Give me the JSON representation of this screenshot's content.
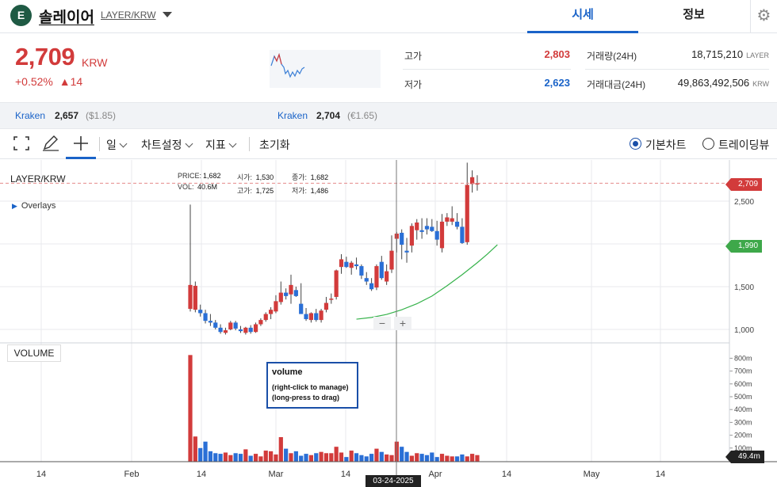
{
  "header": {
    "logo_letter": "E",
    "coin_name": "솔레이어",
    "pair": "LAYER/KRW",
    "tabs": [
      "시세",
      "정보"
    ],
    "settings_icon": "gear-icon"
  },
  "price": {
    "current": "2,709",
    "unit": "KRW",
    "change_pct": "+0.52%",
    "change_amt": "▲14"
  },
  "stats": {
    "high_label": "고가",
    "high": "2,803",
    "low_label": "저가",
    "low": "2,623",
    "volume_label": "거래량(24H)",
    "volume": "18,715,210",
    "volume_unit": "LAYER",
    "value_label": "거래대금(24H)",
    "value": "49,863,492,506",
    "value_unit": "KRW"
  },
  "exchanges": [
    {
      "name": "Kraken",
      "price": "2,657",
      "sub": "($1.85)"
    },
    {
      "name": "Kraken",
      "price": "2,704",
      "sub": "(€1.65)"
    }
  ],
  "toolbar": {
    "interval": "일",
    "settings": "차트설정",
    "indicators": "지표",
    "reset": "초기화",
    "basic_chart": "기본차트",
    "tradingview": "트레이딩뷰"
  },
  "chart": {
    "symbol": "LAYER/KRW",
    "overlays": "Overlays",
    "ohlc": {
      "price_label": "PRICE:",
      "price": "1,682",
      "open_label": "시가:",
      "open": "1,530",
      "close_label": "종가:",
      "close": "1,682",
      "vol_label": "VOL:",
      "vol": "40.6M",
      "high_label": "고가:",
      "high": "1,725",
      "low_label": "저가:",
      "low": "1,486"
    },
    "volume_label": "VOLUME",
    "tooltip_title": "volume",
    "tooltip_line1": "(right-click to manage)",
    "tooltip_line2": "(long-press to drag)",
    "current_price_tag": "2,709",
    "ma_tag": "1,990",
    "volume_tag": "49.4m",
    "crosshair_date": "03-24-2025",
    "zoom_out": "−",
    "zoom_in": "+"
  },
  "chart_data": {
    "type": "candlestick",
    "title": "LAYER/KRW",
    "price_axis_ticks": [
      "2,500",
      "2,000",
      "1,500",
      "1,000"
    ],
    "volume_axis_ticks": [
      "800m",
      "700m",
      "600m",
      "500m",
      "400m",
      "300m",
      "200m",
      "100m"
    ],
    "x_axis_ticks": [
      "14",
      "Feb",
      "14",
      "Mar",
      "14",
      "Apr",
      "14",
      "May",
      "14"
    ],
    "ylim_price": [
      900,
      2900
    ],
    "ylim_volume": [
      0,
      830
    ],
    "candles": [
      {
        "o": 1240,
        "h": 2460,
        "l": 1210,
        "c": 1520
      },
      {
        "o": 1230,
        "h": 1560,
        "l": 1200,
        "c": 1510
      },
      {
        "o": 1230,
        "h": 1290,
        "l": 1150,
        "c": 1190
      },
      {
        "o": 1190,
        "h": 1230,
        "l": 1070,
        "c": 1100
      },
      {
        "o": 1100,
        "h": 1180,
        "l": 1040,
        "c": 1080
      },
      {
        "o": 1080,
        "h": 1110,
        "l": 1000,
        "c": 1020
      },
      {
        "o": 1020,
        "h": 1060,
        "l": 950,
        "c": 970
      },
      {
        "o": 960,
        "h": 1020,
        "l": 940,
        "c": 990
      },
      {
        "o": 1000,
        "h": 1100,
        "l": 990,
        "c": 1080
      },
      {
        "o": 1080,
        "h": 1100,
        "l": 990,
        "c": 1010
      },
      {
        "o": 1000,
        "h": 1040,
        "l": 960,
        "c": 980
      },
      {
        "o": 960,
        "h": 1030,
        "l": 940,
        "c": 1020
      },
      {
        "o": 1020,
        "h": 1050,
        "l": 950,
        "c": 970
      },
      {
        "o": 970,
        "h": 1080,
        "l": 960,
        "c": 1060
      },
      {
        "o": 1060,
        "h": 1130,
        "l": 1040,
        "c": 1110
      },
      {
        "o": 1110,
        "h": 1200,
        "l": 1090,
        "c": 1180
      },
      {
        "o": 1180,
        "h": 1260,
        "l": 1120,
        "c": 1230
      },
      {
        "o": 1210,
        "h": 1400,
        "l": 1190,
        "c": 1330
      },
      {
        "o": 1320,
        "h": 1560,
        "l": 1290,
        "c": 1430
      },
      {
        "o": 1430,
        "h": 1480,
        "l": 1350,
        "c": 1390
      },
      {
        "o": 1410,
        "h": 1640,
        "l": 1300,
        "c": 1520
      },
      {
        "o": 1460,
        "h": 1500,
        "l": 1380,
        "c": 1390
      },
      {
        "o": 1300,
        "h": 1540,
        "l": 1220,
        "c": 1180
      },
      {
        "o": 1180,
        "h": 1250,
        "l": 1100,
        "c": 1120
      },
      {
        "o": 1110,
        "h": 1200,
        "l": 1080,
        "c": 1190
      },
      {
        "o": 1190,
        "h": 1240,
        "l": 1090,
        "c": 1110
      },
      {
        "o": 1110,
        "h": 1240,
        "l": 1080,
        "c": 1220
      },
      {
        "o": 1230,
        "h": 1380,
        "l": 1200,
        "c": 1310
      },
      {
        "o": 1360,
        "h": 1420,
        "l": 1300,
        "c": 1360
      },
      {
        "o": 1380,
        "h": 1700,
        "l": 1350,
        "c": 1690
      },
      {
        "o": 1730,
        "h": 1880,
        "l": 1650,
        "c": 1820
      },
      {
        "o": 1790,
        "h": 1850,
        "l": 1720,
        "c": 1730
      },
      {
        "o": 1720,
        "h": 1800,
        "l": 1640,
        "c": 1780
      },
      {
        "o": 1760,
        "h": 1840,
        "l": 1700,
        "c": 1740
      },
      {
        "o": 1740,
        "h": 1760,
        "l": 1590,
        "c": 1630
      },
      {
        "o": 1600,
        "h": 1670,
        "l": 1520,
        "c": 1560
      },
      {
        "o": 1540,
        "h": 1600,
        "l": 1450,
        "c": 1470
      },
      {
        "o": 1490,
        "h": 1760,
        "l": 1460,
        "c": 1740
      },
      {
        "o": 1790,
        "h": 1860,
        "l": 1580,
        "c": 1600
      },
      {
        "o": 1560,
        "h": 1760,
        "l": 1520,
        "c": 1680
      },
      {
        "o": 1700,
        "h": 2100,
        "l": 1660,
        "c": 1920
      },
      {
        "o": 2060,
        "h": 2140,
        "l": 1900,
        "c": 2120
      },
      {
        "o": 2130,
        "h": 2170,
        "l": 1820,
        "c": 1990
      },
      {
        "o": 1920,
        "h": 2070,
        "l": 1780,
        "c": 1900
      },
      {
        "o": 1980,
        "h": 2240,
        "l": 1900,
        "c": 2210
      },
      {
        "o": 2160,
        "h": 2290,
        "l": 2050,
        "c": 2250
      },
      {
        "o": 2160,
        "h": 2300,
        "l": 2060,
        "c": 2140
      },
      {
        "o": 2210,
        "h": 2300,
        "l": 2110,
        "c": 2170
      },
      {
        "o": 2200,
        "h": 2290,
        "l": 2140,
        "c": 2150
      },
      {
        "o": 2150,
        "h": 2270,
        "l": 1980,
        "c": 2050
      },
      {
        "o": 1950,
        "h": 2350,
        "l": 1900,
        "c": 2260
      },
      {
        "o": 2260,
        "h": 2360,
        "l": 2210,
        "c": 2310
      },
      {
        "o": 2260,
        "h": 2440,
        "l": 2220,
        "c": 2300
      },
      {
        "o": 2260,
        "h": 2360,
        "l": 2170,
        "c": 2200
      },
      {
        "o": 2200,
        "h": 2300,
        "l": 2000,
        "c": 2010
      },
      {
        "o": 2020,
        "h": 2950,
        "l": 1990,
        "c": 2690
      },
      {
        "o": 2700,
        "h": 2860,
        "l": 2600,
        "c": 2780
      },
      {
        "o": 2700,
        "h": 2803,
        "l": 2623,
        "c": 2709
      }
    ],
    "ma_line": [
      [
        33,
        1120
      ],
      [
        36,
        1140
      ],
      [
        39,
        1175
      ],
      [
        42,
        1230
      ],
      [
        45,
        1300
      ],
      [
        48,
        1390
      ],
      [
        51,
        1510
      ],
      [
        54,
        1640
      ],
      [
        57,
        1780
      ],
      [
        59,
        1880
      ],
      [
        61,
        1990
      ]
    ],
    "volumes": [
      825,
      190,
      100,
      150,
      75,
      60,
      55,
      65,
      45,
      60,
      55,
      90,
      40,
      55,
      35,
      80,
      75,
      50,
      185,
      95,
      60,
      75,
      40,
      55,
      45,
      60,
      70,
      60,
      60,
      110,
      65,
      30,
      80,
      60,
      45,
      35,
      55,
      95,
      70,
      50,
      45,
      150,
      110,
      70,
      40,
      60,
      55,
      45,
      65,
      30,
      55,
      40,
      35,
      35,
      50,
      35,
      55,
      45
    ]
  }
}
